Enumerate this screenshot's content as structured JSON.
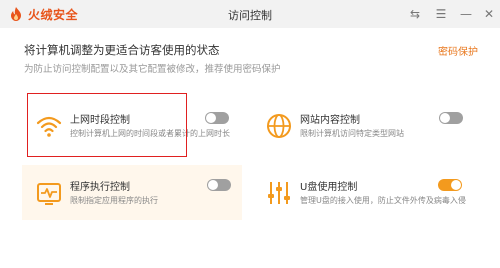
{
  "app": {
    "name": "火绒安全",
    "window_title": "访问控制"
  },
  "window_controls": {
    "restore": "⇆",
    "menu": "☰",
    "minimize": "—",
    "close": "✕"
  },
  "page": {
    "title": "将计算机调整为更适合访客使用的状态",
    "subtitle": "为防止访问控制配置以及其它配置被修改，推荐使用密码保护",
    "password_link": "密码保护"
  },
  "features": [
    {
      "title": "上网时段控制",
      "desc": "控制计算机上网的时间段或者累计的上网时长",
      "enabled": false,
      "icon": "wifi-icon"
    },
    {
      "title": "网站内容控制",
      "desc": "限制计算机访问特定类型网站",
      "enabled": false,
      "icon": "globe-icon"
    },
    {
      "title": "程序执行控制",
      "desc": "限制指定应用程序的执行",
      "enabled": false,
      "icon": "monitor-pulse-icon"
    },
    {
      "title": "U盘使用控制",
      "desc": "管理U盘的接入使用，防止文件外传及病毒入侵",
      "enabled": true,
      "icon": "usb-slider-icon"
    }
  ],
  "colors": {
    "brand": "#e8541b",
    "accent": "#f39a1e",
    "highlight": "#e02020"
  }
}
